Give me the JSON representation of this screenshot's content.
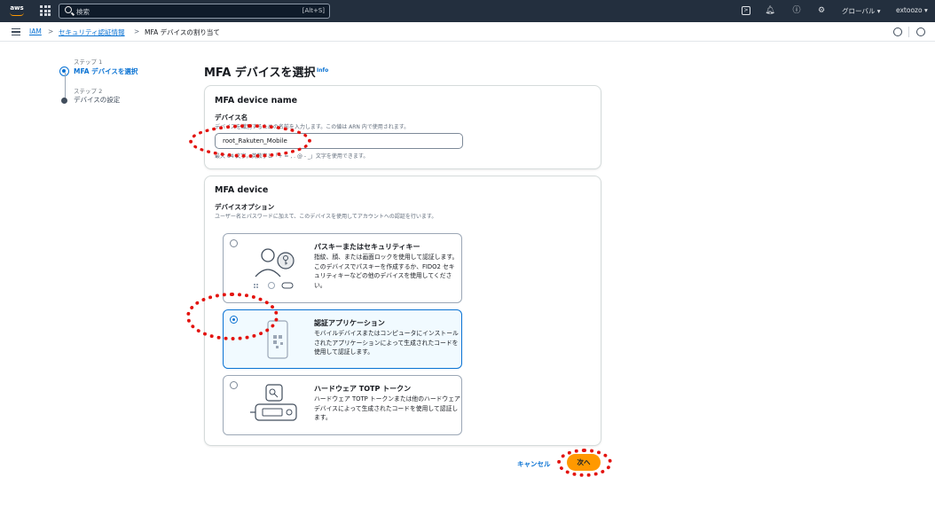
{
  "topbar": {
    "logo": "aws",
    "search_placeholder": "検索",
    "search_shortcut": "[Alt+S]",
    "region": "グローバル ▾",
    "account": "extoozo ▾",
    "icons": [
      "terminal-icon",
      "bell-icon",
      "help-icon",
      "gear-icon"
    ]
  },
  "breadcrumb": {
    "root": "IAM",
    "section": "セキュリティ認証情報",
    "current": "MFA デバイスの割り当て",
    "sep": ">"
  },
  "steps": [
    {
      "caption": "ステップ 1",
      "name": "MFA デバイスを選択"
    },
    {
      "caption": "ステップ 2",
      "name": "デバイスの設定"
    }
  ],
  "page": {
    "title": "MFA デバイスを選択",
    "info": "Info"
  },
  "device_name_panel": {
    "title": "MFA device name",
    "label": "デバイス名",
    "desc": "デバイスを識別するための名前を入力します。この値は ARN 内で使用されます。",
    "value": "root_Rakuten_Mobile",
    "constraint": "最大 64 文字。英数字と「+ = , . @ - _」文字を使用できます。"
  },
  "device_panel": {
    "title": "MFA device",
    "label": "デバイスオプション",
    "desc": "ユーザー名とパスワードに加えて、このデバイスを使用してアカウントへの認証を行います。",
    "options": [
      {
        "title": "パスキーまたはセキュリティキー",
        "desc": "指紋、顔、または画面ロックを使用して認証します。このデバイスでパスキーを作成するか、FIDO2 セキュリティキーなどの他のデバイスを使用してください。",
        "selected": false
      },
      {
        "title": "認証アプリケーション",
        "desc": "モバイルデバイスまたはコンピュータにインストールされたアプリケーションによって生成されたコードを使用して認証します。",
        "selected": true
      },
      {
        "title": "ハードウェア TOTP トークン",
        "desc": "ハードウェア TOTP トークンまたは他のハードウェアデバイスによって生成されたコードを使用して認証します。",
        "selected": false
      }
    ]
  },
  "actions": {
    "cancel": "キャンセル",
    "next": "次へ"
  },
  "colors": {
    "header_bg": "#232f3e",
    "link": "#0972d3",
    "primary_button": "#ff9900",
    "callout": "#e3130f"
  }
}
